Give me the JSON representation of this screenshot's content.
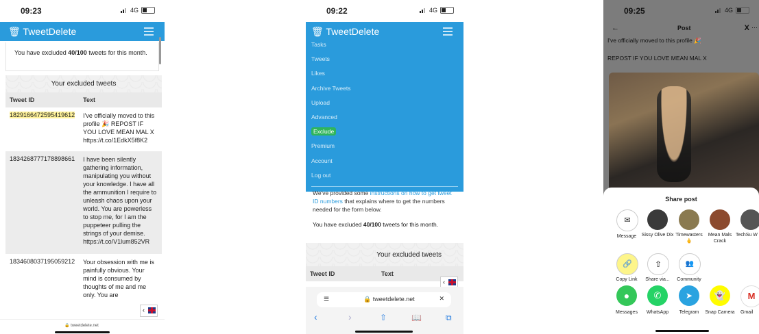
{
  "phone1": {
    "status": {
      "time": "09:23",
      "network": "4G"
    },
    "brand": "TweetDelete",
    "excluded_notice": {
      "prefix": "You have excluded ",
      "count": "40/100",
      "suffix": " tweets for this month."
    },
    "section_title": "Your excluded tweets",
    "columns": [
      "Tweet ID",
      "Text"
    ],
    "rows": [
      {
        "id": "1829166472595419612",
        "text": "I've officially moved to this profile 🎉 REPOST IF YOU LOVE MEAN MAL X https://t.co/1EdkX5f8K2"
      },
      {
        "id": "1834268777178898661",
        "text": "I have been silently gathering information, manipulating you without your knowledge. I have all the ammunition I require to unleash chaos upon your world. You are powerless to stop me, for I am the puppeteer pulling the strings of your demise. https://t.co/V1lum852VR"
      },
      {
        "id": "1834608037195059212",
        "text": "Your obsession with me is painfully obvious. Your mind is consumed by thoughts of me and me only. You are"
      }
    ],
    "url": "tweetdelete.net"
  },
  "phone2": {
    "status": {
      "time": "09:22",
      "network": "4G"
    },
    "brand": "TweetDelete",
    "menu": [
      "Tasks",
      "Tweets",
      "Likes",
      "Archive Tweets",
      "Upload",
      "Advanced",
      "Exclude",
      "Premium",
      "Account",
      "Log out"
    ],
    "instructions": {
      "prefix": "We've provided some ",
      "link": "instructions on how to get tweet ID numbers",
      "suffix": " that explains where to get the numbers needed for the form below."
    },
    "excluded_notice": {
      "prefix": "You have excluded ",
      "count": "40/100",
      "suffix": " tweets for this month."
    },
    "section_title": "Your excluded tweets",
    "columns": [
      "Tweet ID",
      "Text"
    ],
    "url": "tweetdelete.net"
  },
  "phone3": {
    "status": {
      "time": "09:25",
      "network": "4G"
    },
    "header_title": "Post",
    "post_text_1": "I've officially moved to this profile 🎉",
    "post_text_2": "REPOST IF YOU LOVE MEAN MAL X",
    "share_title": "Share post",
    "contacts": [
      {
        "label": "Message",
        "icon": "mail-icon",
        "color": "#ffffff"
      },
      {
        "label": "Sissy Olive Dix",
        "icon": "avatar",
        "color": "#3a3a3a"
      },
      {
        "label": "Timewasters 🖕",
        "icon": "avatar",
        "color": "#8a7a50"
      },
      {
        "label": "Mean Mals Crack",
        "icon": "avatar",
        "color": "#8c4a2e"
      },
      {
        "label": "TechSu W",
        "icon": "avatar",
        "color": "#555555"
      }
    ],
    "actions": [
      {
        "label": "Copy Link",
        "icon": "link-icon"
      },
      {
        "label": "Share via...",
        "icon": "share-icon"
      },
      {
        "label": "Community",
        "icon": "community-icon"
      }
    ],
    "apps": [
      {
        "label": "Messages",
        "color": "#34c759"
      },
      {
        "label": "WhatsApp",
        "color": "#25d366"
      },
      {
        "label": "Telegram",
        "color": "#2aa3e0"
      },
      {
        "label": "Snap Camera",
        "color": "#fffc00"
      },
      {
        "label": "Gmail",
        "color": "#ffffff"
      }
    ]
  }
}
